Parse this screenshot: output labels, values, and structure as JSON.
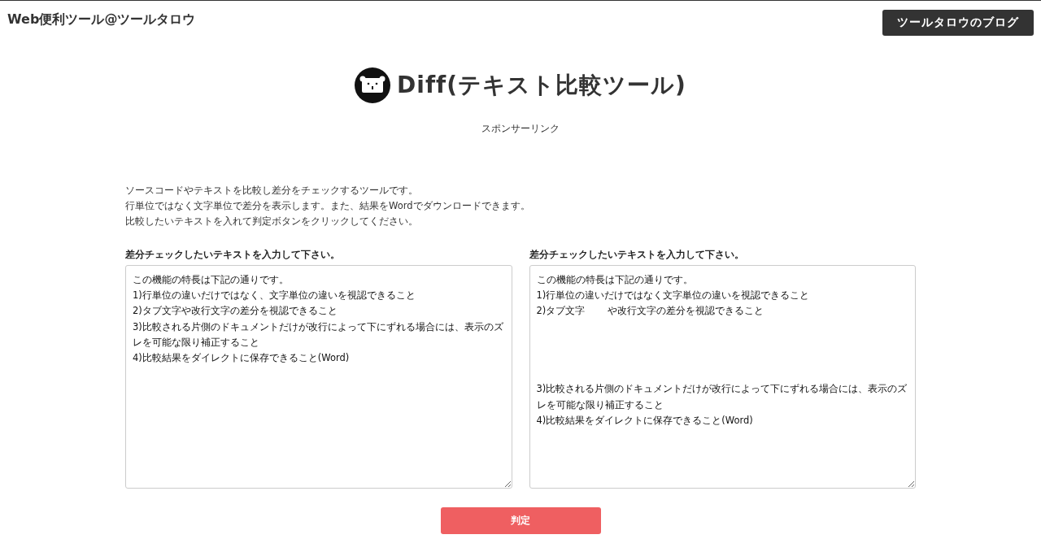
{
  "header": {
    "site_title": "Web便利ツール@ツールタロウ",
    "blog_button": "ツールタロウのブログ"
  },
  "page_title": "Diff(テキスト比較ツール)",
  "sponsor_label": "スポンサーリンク",
  "description": [
    "ソースコードやテキストを比較し差分をチェックするツールです。",
    "行単位ではなく文字単位で差分を表示します。また、結果をWordでダウンロードできます。",
    "比較したいテキストを入れて判定ボタンをクリックしてください。"
  ],
  "inputs": [
    {
      "label": "差分チェックしたいテキストを入力して下さい。",
      "value": "この機能の特長は下記の通りです。\n1)行単位の違いだけではなく、文字単位の違いを視認できること\n2)タブ文字や改行文字の差分を視認できること\n3)比較される片側のドキュメントだけが改行によって下にずれる場合には、表示のズレを可能な限り補正すること\n4)比較結果をダイレクトに保存できること(Word)"
    },
    {
      "label": "差分チェックしたいテキストを入力して下さい。",
      "value": "この機能の特長は下記の通りです。\n1)行単位の違いだけではなく文字単位の違いを視認できること\n2)タブ文字\t\tや改行文字の差分を視認できること\n\n\n\n\n3)比較される片側のドキュメントだけが改行によって下にずれる場合には、表示のズレを可能な限り補正すること\n4)比較結果をダイレクトに保存できること(Word)"
    }
  ],
  "submit_button": "判定"
}
